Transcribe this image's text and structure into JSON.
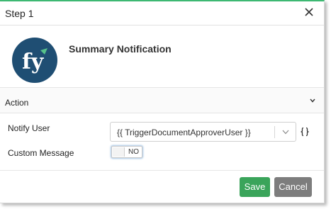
{
  "dialog": {
    "title": "Step 1",
    "heading": "Summary Notification",
    "accent_color": "#3db872",
    "logo": {
      "text": "fy",
      "bg_color": "#1f4e73",
      "accent_color": "#57c28a"
    }
  },
  "section": {
    "title": "Action"
  },
  "form": {
    "notify_user": {
      "label": "Notify User",
      "value": "{{ TriggerDocumentApproverUser }}"
    },
    "custom_message": {
      "label": "Custom Message",
      "toggle_text": "NO",
      "toggle_on": false
    }
  },
  "buttons": {
    "save": "Save",
    "cancel": "Cancel",
    "save_color": "#3aa45a",
    "cancel_color": "#7d7d7d"
  }
}
